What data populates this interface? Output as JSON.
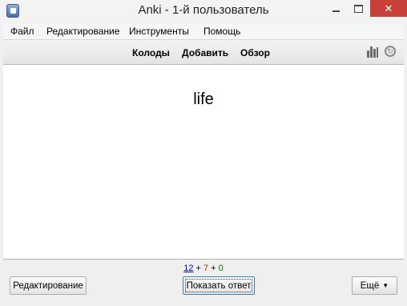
{
  "window": {
    "title": "Anki - 1-й пользователь",
    "close_glyph": "✕"
  },
  "menubar": {
    "items": [
      "Файл",
      "Редактирование",
      "Инструменты",
      "Помощь"
    ]
  },
  "toolbar": {
    "decks": "Колоды",
    "add": "Добавить",
    "browse": "Обзор",
    "icons": [
      "stats-icon",
      "sync-icon"
    ]
  },
  "card": {
    "question": "life"
  },
  "counts": {
    "new": "12",
    "sep1": " + ",
    "learning": "7",
    "sep2": " + ",
    "review": "0",
    "colors": {
      "new": "#0000c8",
      "learning": "#b34000",
      "review": "#007a00"
    }
  },
  "bottom": {
    "edit_label": "Редактирование",
    "show_answer_label": "Показать ответ",
    "more_label": "Ещё",
    "more_caret": "▼"
  }
}
